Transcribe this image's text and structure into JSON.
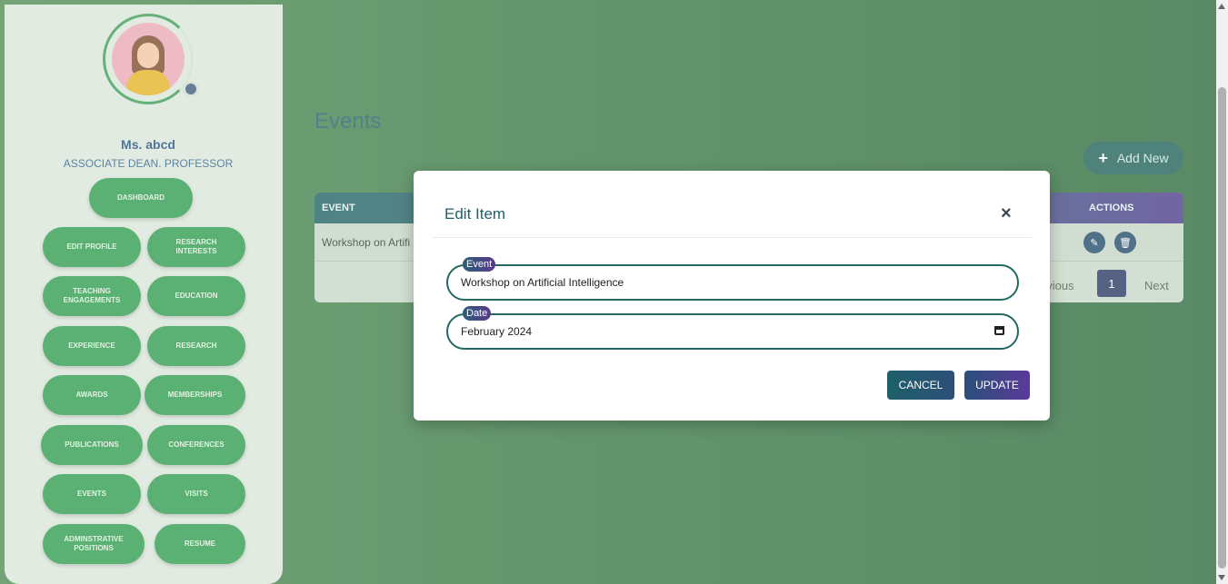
{
  "profile": {
    "name": "Ms. abcd",
    "title": "ASSOCIATE DEAN. PROFESSOR"
  },
  "sidebar": {
    "dashboard": "DASHBOARD",
    "edit_profile": "EDIT PROFILE",
    "research_interests": "RESEARCH INTERESTS",
    "teaching_engagements": "TEACHING ENGAGEMENTS",
    "education": "EDUCATION",
    "experience": "EXPERIENCE",
    "research": "RESEARCH",
    "awards": "AWARDS",
    "memberships": "MEMBERSHIPS",
    "publications": "PUBLICATIONS",
    "conferences": "CONFERENCES",
    "events": "EVENTS",
    "visits": "VISITS",
    "administrative_positions": "ADMINSTRATIVE POSITIONS",
    "resume": "RESUME"
  },
  "page": {
    "title": "Events",
    "add_new": "Add New",
    "add_new_icon": "plus-icon"
  },
  "table": {
    "headers": {
      "event": "EVENT",
      "actions": "ACTIONS"
    },
    "rows": [
      {
        "event": "Workshop on Artifi"
      }
    ],
    "actions_icons": [
      "edit-icon",
      "delete-icon"
    ],
    "pagination": {
      "previous": "evious",
      "current": "1",
      "next": "Next"
    }
  },
  "modal": {
    "title": "Edit Item",
    "close": "×",
    "event_label": "Event",
    "event_value": "Workshop on Artificial Intelligence",
    "date_label": "Date",
    "date_value": "February 2024",
    "cancel": "CANCEL",
    "update": "UPDATE"
  },
  "colors": {
    "brand_green": "#2e9a4e",
    "teal": "#1f5f6a",
    "purple": "#5a3a9a"
  }
}
